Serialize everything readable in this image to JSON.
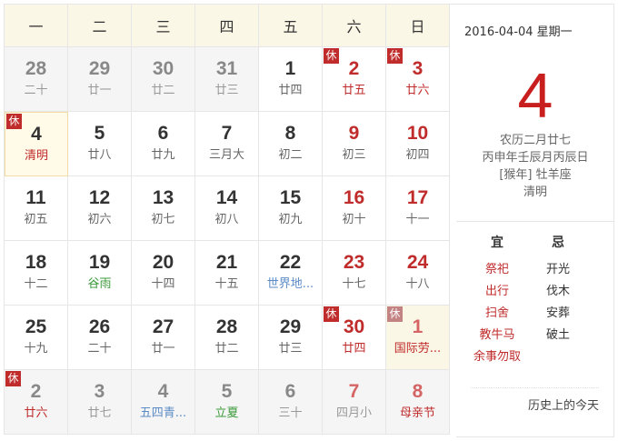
{
  "weekdays": [
    "一",
    "二",
    "三",
    "四",
    "五",
    "六",
    "日"
  ],
  "days": [
    {
      "n": "28",
      "l": "二十",
      "type": "other"
    },
    {
      "n": "29",
      "l": "廿一",
      "type": "other"
    },
    {
      "n": "30",
      "l": "廿二",
      "type": "other"
    },
    {
      "n": "31",
      "l": "廿三",
      "type": "other"
    },
    {
      "n": "1",
      "l": "廿四"
    },
    {
      "n": "2",
      "l": "廿五",
      "weekend": true,
      "badge": "休",
      "lunarColor": "red"
    },
    {
      "n": "3",
      "l": "廿六",
      "weekend": true,
      "badge": "休",
      "lunarColor": "red"
    },
    {
      "n": "4",
      "l": "清明",
      "badge": "休",
      "selected": true,
      "lunarColor": "red"
    },
    {
      "n": "5",
      "l": "廿八"
    },
    {
      "n": "6",
      "l": "廿九"
    },
    {
      "n": "7",
      "l": "三月大"
    },
    {
      "n": "8",
      "l": "初二"
    },
    {
      "n": "9",
      "l": "初三",
      "weekend": true
    },
    {
      "n": "10",
      "l": "初四",
      "weekend": true
    },
    {
      "n": "11",
      "l": "初五"
    },
    {
      "n": "12",
      "l": "初六"
    },
    {
      "n": "13",
      "l": "初七"
    },
    {
      "n": "14",
      "l": "初八"
    },
    {
      "n": "15",
      "l": "初九"
    },
    {
      "n": "16",
      "l": "初十",
      "weekend": true
    },
    {
      "n": "17",
      "l": "十一",
      "weekend": true
    },
    {
      "n": "18",
      "l": "十二"
    },
    {
      "n": "19",
      "l": "谷雨",
      "lunarColor": "green"
    },
    {
      "n": "20",
      "l": "十四"
    },
    {
      "n": "21",
      "l": "十五"
    },
    {
      "n": "22",
      "l": "世界地...",
      "lunarColor": "blue"
    },
    {
      "n": "23",
      "l": "十七",
      "weekend": true
    },
    {
      "n": "24",
      "l": "十八",
      "weekend": true
    },
    {
      "n": "25",
      "l": "十九"
    },
    {
      "n": "26",
      "l": "二十"
    },
    {
      "n": "27",
      "l": "廿一"
    },
    {
      "n": "28",
      "l": "廿二"
    },
    {
      "n": "29",
      "l": "廿三"
    },
    {
      "n": "30",
      "l": "廿四",
      "weekend": true,
      "badge": "休",
      "lunarColor": "red"
    },
    {
      "n": "1",
      "l": "国际劳...",
      "type": "other",
      "weekend": true,
      "badge": "休",
      "holidayBg": true,
      "lunarColor": "red",
      "badgeGray": true
    },
    {
      "n": "2",
      "l": "廿六",
      "type": "other",
      "badge": "休",
      "lunarColor": "red"
    },
    {
      "n": "3",
      "l": "廿七",
      "type": "other"
    },
    {
      "n": "4",
      "l": "五四青...",
      "type": "other",
      "lunarColor": "blue"
    },
    {
      "n": "5",
      "l": "立夏",
      "type": "other",
      "lunarColor": "green"
    },
    {
      "n": "6",
      "l": "三十",
      "type": "other"
    },
    {
      "n": "7",
      "l": "四月小",
      "type": "other",
      "weekend": true
    },
    {
      "n": "8",
      "l": "母亲节",
      "type": "other",
      "weekend": true,
      "lunarColor": "red"
    }
  ],
  "side": {
    "date": "2016-04-04  星期一",
    "day": "4",
    "lunar": "农历二月廿七",
    "ganzhi": "丙申年壬辰月丙辰日",
    "zodiac": "[猴年] 牡羊座",
    "term": "清明",
    "yi_title": "宜",
    "ji_title": "忌",
    "yi": [
      "祭祀",
      "出行",
      "扫舍",
      "教牛马",
      "余事勿取"
    ],
    "ji": [
      "开光",
      "伐木",
      "安葬",
      "破土"
    ],
    "history": "历史上的今天"
  }
}
